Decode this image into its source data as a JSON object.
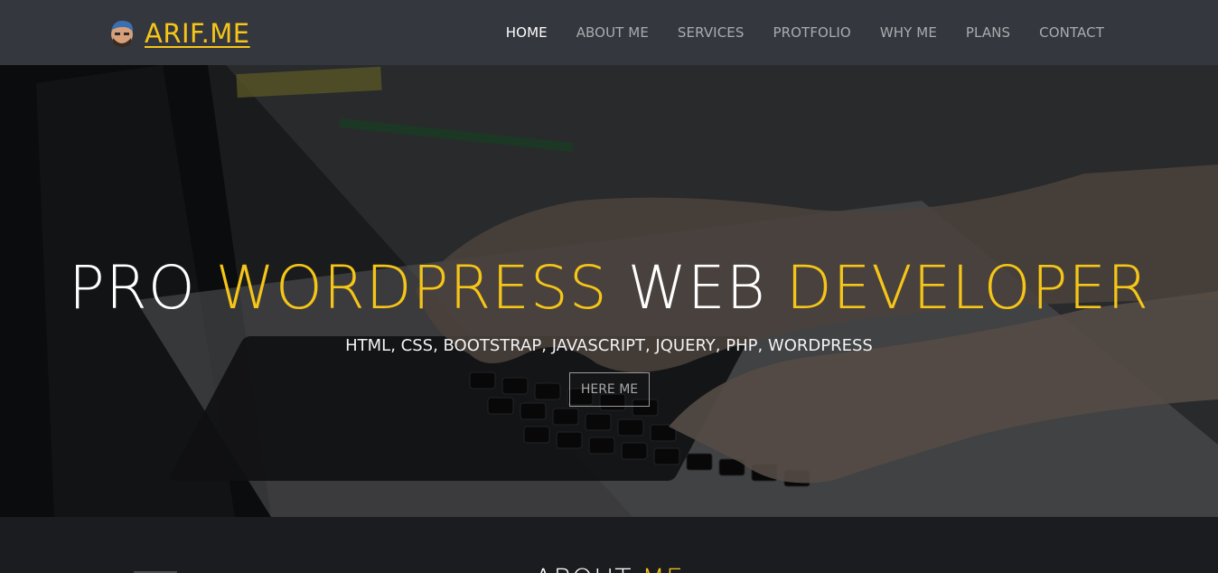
{
  "brand": {
    "text": "ARIF.ME",
    "icon": "avatar-icon"
  },
  "nav": {
    "items": [
      {
        "label": "HOME",
        "active": true
      },
      {
        "label": "ABOUT ME"
      },
      {
        "label": "SERVICES"
      },
      {
        "label": "PROTFOLIO"
      },
      {
        "label": "WHY ME"
      },
      {
        "label": "PLANS"
      },
      {
        "label": "CONTACT"
      }
    ]
  },
  "hero": {
    "title_parts": [
      "PRO",
      "WORDPRESS",
      "WEB",
      "DEVELOPER"
    ],
    "subtitle": "HTML, CSS, BOOTSTRAP, JAVASCRIPT, JQUERY, PHP, WORDPRESS",
    "button_label": "HERE ME"
  },
  "about": {
    "title_a": "ABOUT",
    "title_b": "ME"
  },
  "colors": {
    "accent": "#f5c518",
    "navbar": "#34373d",
    "page_bg": "#1b1c1f"
  }
}
